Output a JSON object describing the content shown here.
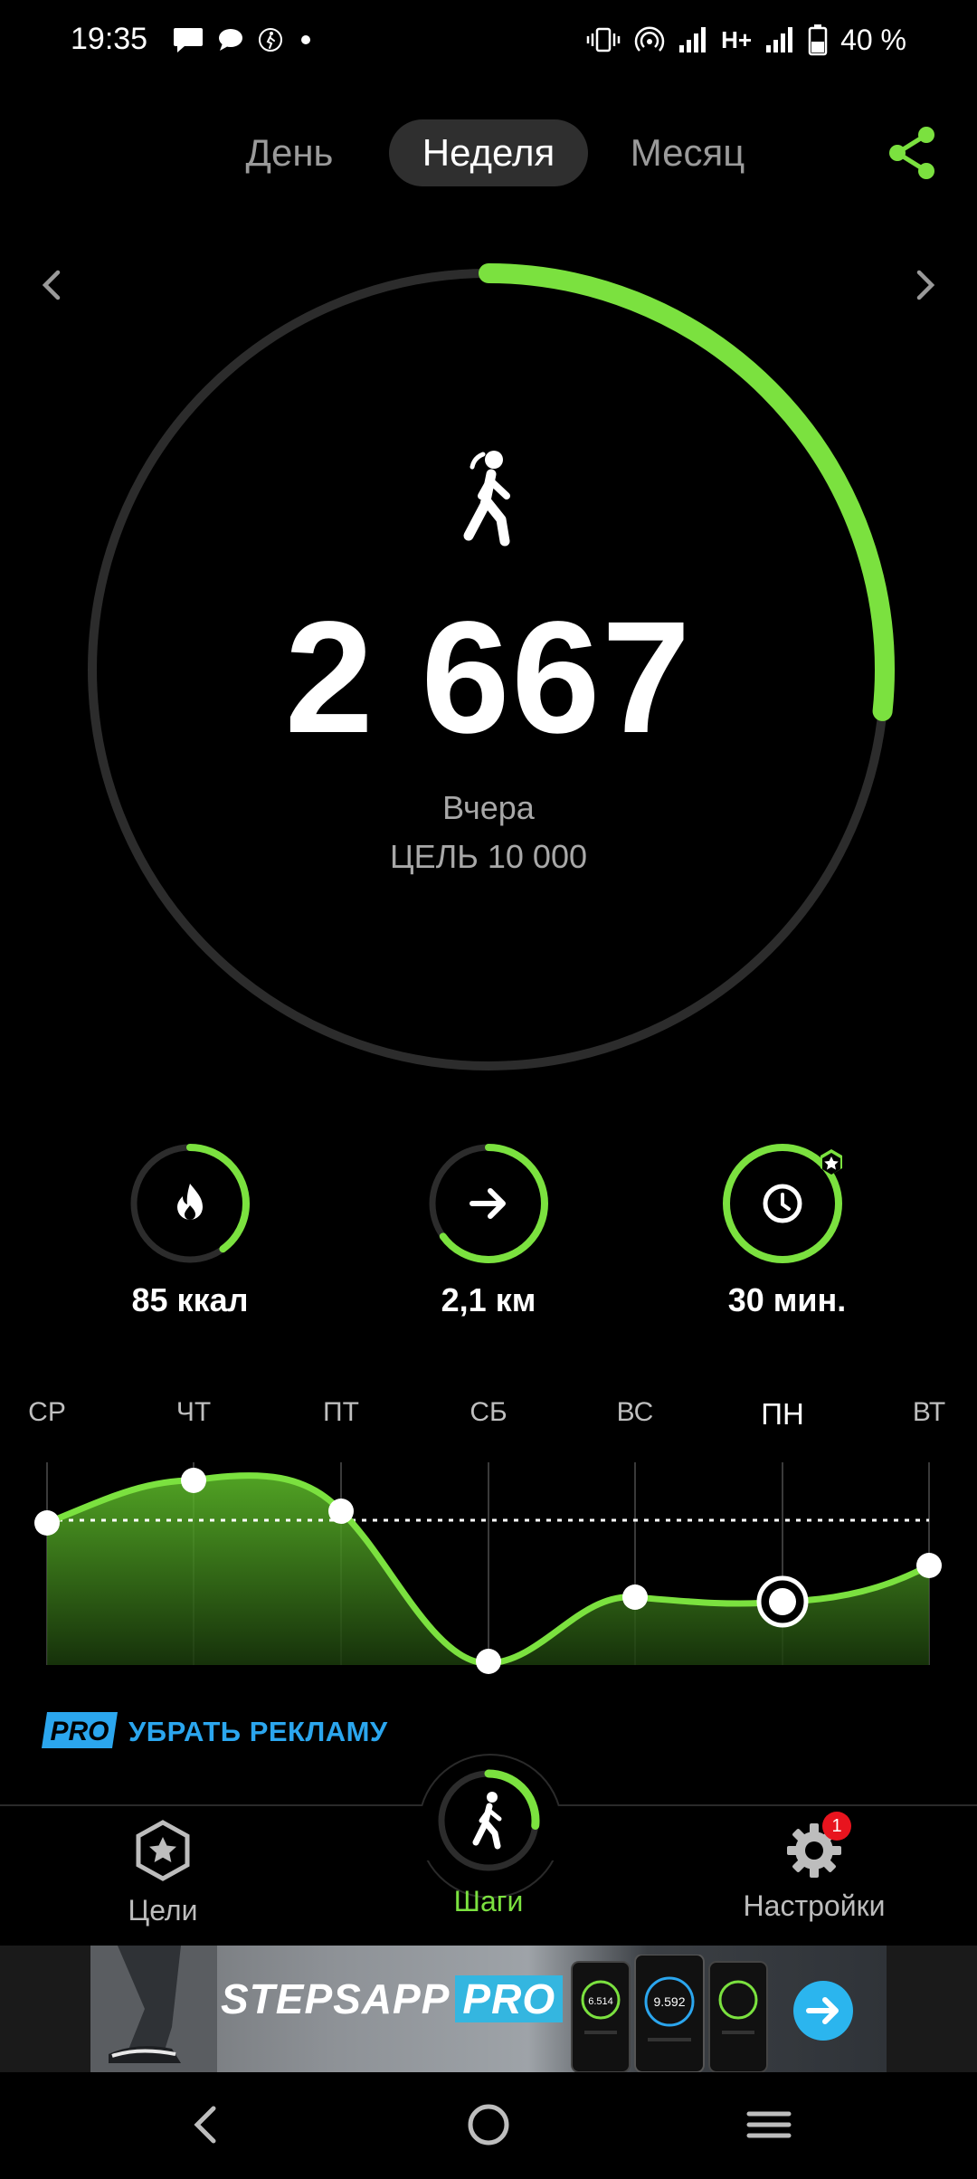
{
  "status_bar": {
    "time": "19:35",
    "network": "H+",
    "battery": "40 %",
    "icons": [
      "message-icon",
      "chat-icon",
      "steps-app-icon",
      "dot-icon",
      "vibrate-icon",
      "hotspot-icon",
      "signal-icon",
      "signal-icon",
      "battery-icon"
    ]
  },
  "tabs": [
    {
      "label": "День",
      "active": false
    },
    {
      "label": "Неделя",
      "active": true
    },
    {
      "label": "Месяц",
      "active": false
    }
  ],
  "summary": {
    "steps": "2 667",
    "day": "Вчера",
    "goal": "ЦЕЛЬ 10 000",
    "progress_fraction": 0.2667
  },
  "stats": [
    {
      "icon": "flame-icon",
      "label": "85 ккал",
      "progress": 0.4
    },
    {
      "icon": "arrow-right-icon",
      "label": "2,1 км",
      "progress": 0.65
    },
    {
      "icon": "clock-icon",
      "label": "30 мин.",
      "progress": 1.0
    }
  ],
  "week_chart": {
    "days": [
      "СР",
      "ЧТ",
      "ПТ",
      "СБ",
      "ВС",
      "ПН",
      "ВТ"
    ],
    "current_day": "ПН",
    "goal_line": true
  },
  "promo": {
    "badge": "PRO",
    "text": "УБРАТЬ РЕКЛАМУ"
  },
  "bottom_nav": {
    "goals": "Цели",
    "steps": "Шаги",
    "settings": "Настройки",
    "settings_badge": "1"
  },
  "ad": {
    "brand_prefix": "STEPSAPP",
    "brand_suffix": "PRO",
    "phone_values": [
      "6.514",
      "9.592"
    ]
  },
  "colors": {
    "accent": "#7be13f",
    "track": "#2c2c2c",
    "pro_blue": "#2ba6ee"
  }
}
